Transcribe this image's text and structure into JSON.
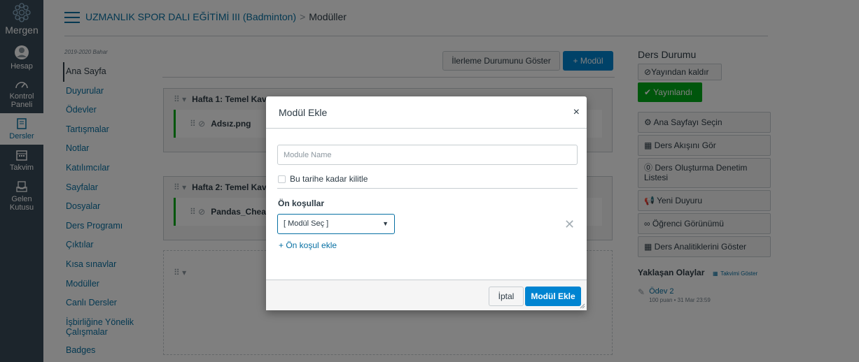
{
  "global_nav": {
    "logo_text": "Mergen",
    "items": [
      {
        "label": "Hesap",
        "icon": "user-icon"
      },
      {
        "label": "Kontrol Paneli",
        "icon": "dashboard-icon"
      },
      {
        "label": "Dersler",
        "icon": "book-icon"
      },
      {
        "label": "Takvim",
        "icon": "calendar-icon"
      },
      {
        "label": "Gelen Kutusu",
        "icon": "inbox-icon"
      }
    ]
  },
  "header": {
    "course_name": "UZMANLIK SPOR DALI EĞİTİMİ III (Badminton)",
    "separator": ">",
    "current_page": "Modüller"
  },
  "course_nav": {
    "term": "2019-2020 Bahar",
    "items": [
      "Ana Sayfa",
      "Duyurular",
      "Ödevler",
      "Tartışmalar",
      "Notlar",
      "Katılımcılar",
      "Sayfalar",
      "Dosyalar",
      "Ders Programı",
      "Çıktılar",
      "Kısa sınavlar",
      "Modüller",
      "Canlı Dersler",
      "İşbirliğine Yönelik Çalışmalar",
      "Badges"
    ],
    "active_index": 0
  },
  "toolbar": {
    "progress_label": "İlerleme Durumunu Göster",
    "add_module_label": "+ Modül"
  },
  "modules": [
    {
      "title": "Hafta 1: Temel Kav",
      "item": "Adsız.png"
    },
    {
      "title": "Hafta 2: Temel Kav",
      "item": "Pandas_Cheat_"
    },
    {
      "title": "",
      "item": ""
    }
  ],
  "sidebar": {
    "status_heading": "Ders Durumu",
    "unpublish_label": "Yayından kaldır",
    "published_label": "Yayınlandı",
    "actions": [
      "Ana Sayfayı Seçin",
      "Ders Akışını Gör",
      "Ders Oluşturma Denetim Listesi",
      "Yeni Duyuru",
      "Öğrenci Görünümü",
      "Ders Analitiklerini Göster"
    ],
    "upcoming_title": "Yaklaşan Olaylar",
    "calendar_link": "Takvimi Göster",
    "event": {
      "title": "Ödev 2",
      "meta": "100 puan • 31 Mar 23:59"
    }
  },
  "modal": {
    "title": "Modül Ekle",
    "close": "×",
    "name_placeholder": "Module Name",
    "lock_label": "Bu tarihe kadar kilitle",
    "prereq_title": "Ön koşullar",
    "prereq_select_value": "[ Modül Seç ]",
    "add_prereq_label": "+ Ön koşul ekle",
    "cancel_label": "İptal",
    "submit_label": "Modül Ekle"
  },
  "colors": {
    "nav_bg": "#394b58",
    "link": "#0770a3",
    "primary_button": "#0084d1",
    "success": "#00ac18"
  }
}
